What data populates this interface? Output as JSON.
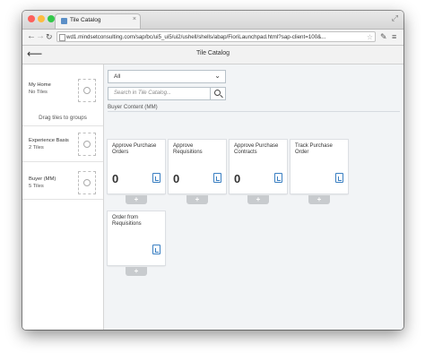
{
  "browser": {
    "tab_title": "Tile Catalog",
    "tab_close": "×",
    "url": "wd1.mindsetconsulting.com/sap/bc/ui5_ui5/ui2/ushell/shells/abap/FioriLaunchpad.html?sap-client=100&...",
    "traffic_colors": [
      "#fc605b",
      "#fdbc40",
      "#34c84a"
    ]
  },
  "header": {
    "title": "Tile Catalog",
    "back_icon": "arrow-left-icon"
  },
  "sidebar": {
    "drag_hint": "Drag tiles to groups",
    "groups": [
      {
        "title": "My Home",
        "count": "No Tiles"
      },
      {
        "title": "Experience Basis",
        "count": "2 Tiles"
      },
      {
        "title": "Buyer (MM)",
        "count": "5 Tiles"
      }
    ]
  },
  "filter": {
    "selected": "All",
    "search_placeholder": "Search in Tile Catalog..."
  },
  "catalog": {
    "title": "Buyer Content (MM)",
    "tiles": [
      {
        "title": "Approve Purchase Orders",
        "number": "0",
        "icon": "document-icon"
      },
      {
        "title": "Approve Requisitions",
        "number": "0",
        "icon": "list-icon"
      },
      {
        "title": "Approve Purchase Contracts",
        "number": "0",
        "icon": "documents-icon"
      },
      {
        "title": "Track Purchase Order",
        "number": "",
        "icon": "document-icon"
      },
      {
        "title": "Order from Requisitions",
        "number": "",
        "icon": "documents-icon"
      }
    ],
    "add_label": "+"
  }
}
